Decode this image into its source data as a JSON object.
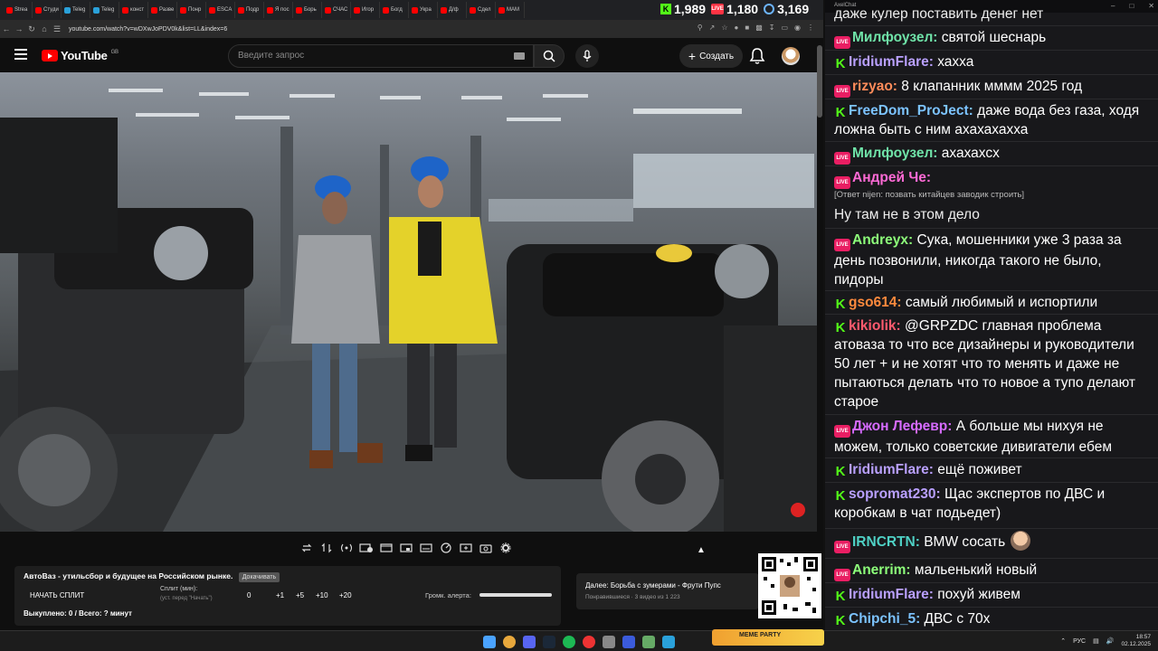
{
  "browser": {
    "tabs": [
      {
        "label": "Strea",
        "color": "#ff0000"
      },
      {
        "label": "Студи",
        "color": "#ff0000"
      },
      {
        "label": "Teleg",
        "color": "#2aa1da"
      },
      {
        "label": "Teleg",
        "color": "#2aa1da"
      },
      {
        "label": "конст",
        "color": "#ff0000"
      },
      {
        "label": "Разве",
        "color": "#ff0000"
      },
      {
        "label": "Понр",
        "color": "#ff0000"
      },
      {
        "label": "ESCA",
        "color": "#ff0000"
      },
      {
        "label": "Подр",
        "color": "#ff0000"
      },
      {
        "label": "Я пос",
        "color": "#ff0000"
      },
      {
        "label": "Борь",
        "color": "#ff0000"
      },
      {
        "label": "СЧАС",
        "color": "#ff0000"
      },
      {
        "label": "Игор",
        "color": "#ff0000"
      },
      {
        "label": "Богд",
        "color": "#ff0000"
      },
      {
        "label": "Укра",
        "color": "#ff0000"
      },
      {
        "label": "Д/ф",
        "color": "#ff0000"
      },
      {
        "label": "Сдел",
        "color": "#ff0000"
      },
      {
        "label": "МАМ",
        "color": "#ff0000"
      }
    ],
    "url": "youtube.com/watch?v=wDXwJoPDV0k&list=LL&index=6"
  },
  "counters": {
    "kick": "1,989",
    "live": "1,180",
    "viewers": "3,169"
  },
  "youtube": {
    "logo_text": "YouTube",
    "country": "GB",
    "search_placeholder": "Введите запрос",
    "create_label": "Создать"
  },
  "extension_panel": {
    "video_title": "АвтоВаз - утильсбор и будущее на Российском рынке.",
    "title_tag": "Докачивать",
    "start_split": "НАЧАТЬ СПЛИТ",
    "split_label": "Сплит (мин):",
    "split_hint": "(уст. перед \"Начать\")",
    "split_value": "0",
    "buttons": [
      "+1",
      "+5",
      "+10",
      "+20"
    ],
    "volume_label": "Громк. алерта:",
    "volume_level": 1.0,
    "bought_text": "Выкуплено: 0 / Всего: ? минут"
  },
  "next_card": {
    "title": "Далее: Борьба с зумерами - Фрути Пупс",
    "subtitle": "Понравившиеся · 3 видео из 1 223"
  },
  "chat": {
    "window_title": "AxelChat",
    "partial_top": "даже кулер поставить денег нет",
    "messages": [
      {
        "src": "live",
        "user": "Милфоузел:",
        "color": "#6fe3a8",
        "text": "святой шеснарь"
      },
      {
        "src": "kick",
        "user": "IridiumFlare:",
        "color": "#b9a0ff",
        "text": "хахха"
      },
      {
        "src": "live",
        "user": "rizyao:",
        "color": "#ff8c5a",
        "text": "8 клапанник мммм 2025 год"
      },
      {
        "src": "kick",
        "user": "FreeDom_ProJect:",
        "color": "#7cc3ff",
        "text": "даже вода без газа, ходя ложна быть с ним ахахахахха"
      },
      {
        "src": "live",
        "user": "Милфоузел:",
        "color": "#6fe3a8",
        "text": "ахахахсх"
      },
      {
        "src": "live",
        "user": "Андрей Че:",
        "color": "#ff6ad5",
        "text": ""
      },
      {
        "src": "live",
        "user": "Andreyx:",
        "color": "#8dff7a",
        "text": "Сука, мошенники уже 3 раза за день позвонили, никогда такого не было, пидоры"
      },
      {
        "src": "kick",
        "user": "gso614:",
        "color": "#ff8a3d",
        "text": "самый любимый и испортили"
      },
      {
        "src": "kick",
        "user": "kikiolik:",
        "color": "#ff5a6e",
        "text": "@GRPZDC главная проблема атоваза то что все дизайнеры и руководители 50 лет + и не хотят что то менять и даже не пытаються делать что то новое а тупо делают старое"
      },
      {
        "src": "live",
        "user": "Джон Лефевр:",
        "color": "#d66bff",
        "text": "А больше мы нихуя не можем, только советские дивигатели ебем"
      },
      {
        "src": "kick",
        "user": "IridiumFlare:",
        "color": "#b9a0ff",
        "text": "ещё поживет"
      },
      {
        "src": "kick",
        "user": "sopromat230:",
        "color": "#b9a0ff",
        "text": "Щас экспертов по ДВС и коробкам в чат подьедет)"
      },
      {
        "src": "live",
        "user": "IRNCRTN:",
        "color": "#4fd1c5",
        "text": "BMW сосать"
      },
      {
        "src": "live",
        "user": "Anerrim:",
        "color": "#8dff7a",
        "text": "мальенький новый"
      },
      {
        "src": "kick",
        "user": "IridiumFlare:",
        "color": "#b9a0ff",
        "text": "похуй живем"
      },
      {
        "src": "kick",
        "user": "Chipchi_5:",
        "color": "#7cc3ff",
        "text": "ДВС с 70х"
      }
    ],
    "reply_note": "[Ответ nijen: позвать китайцев заводик строить]",
    "reply_followup": "Ну там не в этом дело"
  },
  "taskbar": {
    "meme_badge": "MEME PARTY",
    "lang": "РУС",
    "time": "18:57",
    "date": "02.12.2025"
  }
}
